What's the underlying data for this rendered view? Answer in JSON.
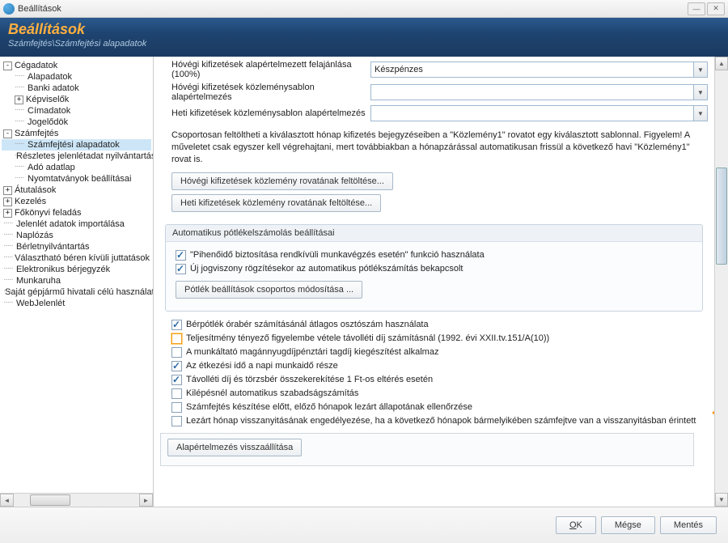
{
  "window": {
    "title": "Beállítások"
  },
  "header": {
    "title": "Beállítások",
    "breadcrumb": "Számfejtés\\Számfejtési alapadatok"
  },
  "tree": {
    "items": [
      {
        "label": "Cégadatok",
        "toggle": "-",
        "level": 1
      },
      {
        "label": "Alapadatok",
        "level": 2
      },
      {
        "label": "Banki adatok",
        "level": 2
      },
      {
        "label": "Képviselők",
        "toggle": "+",
        "level": 2
      },
      {
        "label": "Címadatok",
        "level": 2
      },
      {
        "label": "Jogelődök",
        "level": 2
      },
      {
        "label": "Számfejtés",
        "toggle": "-",
        "level": 1
      },
      {
        "label": "Számfejtési alapadatok",
        "level": 2,
        "selected": true
      },
      {
        "label": "Részletes jelenlétadat nyilvántartás",
        "level": 2
      },
      {
        "label": "Adó adatlap",
        "level": 2
      },
      {
        "label": "Nyomtatványok beállításai",
        "level": 2
      },
      {
        "label": "Átutalások",
        "toggle": "+",
        "level": 1
      },
      {
        "label": "Kezelés",
        "toggle": "+",
        "level": 1
      },
      {
        "label": "Főkönyvi feladás",
        "toggle": "+",
        "level": 1
      },
      {
        "label": "Jelenlét adatok importálása",
        "level": 1
      },
      {
        "label": "Naplózás",
        "level": 1
      },
      {
        "label": "Bérletnyilvántartás",
        "level": 1
      },
      {
        "label": "Választható béren kívüli juttatások",
        "level": 1
      },
      {
        "label": "Elektronikus bérjegyzék",
        "level": 1
      },
      {
        "label": "Munkaruha",
        "level": 1
      },
      {
        "label": "Saját gépjármű hivatali célú használata",
        "level": 1
      },
      {
        "label": "WebJelenlét",
        "level": 1
      }
    ]
  },
  "content": {
    "rows": [
      {
        "label": "Hóvégi kifizetések alapértelmezett felajánlása (100%)",
        "value": "Készpénzes"
      },
      {
        "label": "Hóvégi kifizetések közleménysablon alapértelmezés",
        "value": ""
      },
      {
        "label": "Heti kifizetések közleménysablon alapértelmezés",
        "value": ""
      }
    ],
    "info_text": "Csoportosan feltöltheti a kiválasztott hónap kifizetés bejegyzéseiben a \"Közlemény1\" rovatot egy kiválasztott sablonnal. Figyelem! A műveletet csak egyszer kell végrehajtani, mert továbbiakban a hónapzárással automatikusan frissül a következő havi \"Közlemény1\" rovat is.",
    "btn_hovegi": "Hóvégi kifizetések közlemény rovatának feltöltése...",
    "btn_heti": "Heti kifizetések közlemény rovatának feltöltése...",
    "group_title": "Automatikus pótlékelszámolás beállításai",
    "cb_pihenoido": "\"Pihenőidő biztosítása rendkívüli munkavégzés esetén\" funkció használata",
    "cb_ujjogviszony": "Új jogviszony rögzítésekor az automatikus pótlékszámítás bekapcsolt",
    "btn_potlek": "Pótlék beállítások csoportos módosítása ...",
    "cb_list": [
      {
        "label": "Bérpótlék órabér számításánál átlagos osztószám használata",
        "checked": true
      },
      {
        "label": "Teljesítmény tényező figyelembe vétele távolléti díj számításnál (1992. évi XXII.tv.151/A(10))",
        "checked": false,
        "highlighted": true
      },
      {
        "label": "A munkáltató magánnyugdíjpénztári tagdíj kiegészítést alkalmaz",
        "checked": false
      },
      {
        "label": "Az étkezési idő a napi munkaidő része",
        "checked": true
      },
      {
        "label": "Távolléti díj és törzsbér összekerekítése 1 Ft-os eltérés esetén",
        "checked": true
      },
      {
        "label": "Kilépésnél automatikus szabadságszámítás",
        "checked": false
      },
      {
        "label": "Számfejtés készítése előtt, előző hónapok lezárt állapotának ellenőrzése",
        "checked": false
      },
      {
        "label": "Lezárt hónap visszanyitásának engedélyezése, ha a következő hónapok bármelyikében számfejtve van a visszanyitásban érintett",
        "checked": false
      }
    ],
    "btn_reset": "Alapértelmezés visszaállítása"
  },
  "footer": {
    "ok": "OK",
    "cancel": "Mégse",
    "save": "Mentés"
  }
}
